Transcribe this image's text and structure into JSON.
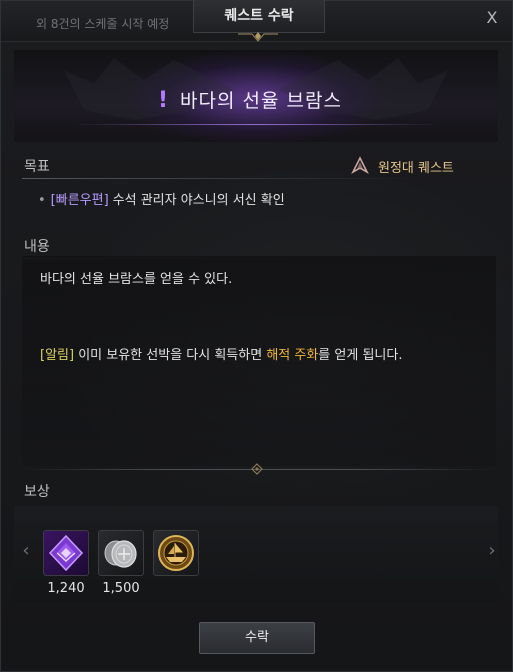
{
  "header": {
    "schedule_notice": "외 8건의 스케줄 시작 예정",
    "title": "퀘스트 수락",
    "close_label": "X"
  },
  "quest": {
    "title": "바다의 선율 브람스",
    "title_prefix": "!",
    "type_label": "원정대 퀘스트"
  },
  "objective": {
    "heading": "목표",
    "bullet": "•",
    "tag": "[빠른우편]",
    "text": "수석 관리자 야스니의 서신 확인"
  },
  "content": {
    "heading": "내용",
    "description": "바다의 선율 브람스를 얻을 수 있다.",
    "notice_tag": "[알림]",
    "notice_before": " 이미 보유한 선박을 다시 획득하면 ",
    "notice_highlight": "해적 주화",
    "notice_after": "를 얻게 됩니다."
  },
  "rewards": {
    "heading": "보상",
    "prev_label": "‹",
    "next_label": "›",
    "items": [
      {
        "icon": "purple-crystal-icon",
        "quantity": "1,240"
      },
      {
        "icon": "silver-coin-icon",
        "quantity": "1,500"
      },
      {
        "icon": "gold-ship-emblem-icon",
        "quantity": ""
      }
    ]
  },
  "actions": {
    "accept_label": "수락"
  },
  "colors": {
    "accent_purple": "#b67cff",
    "tag_purple": "#b89bff",
    "notice_yellow": "#d8d060",
    "highlight_orange": "#f2b63a",
    "type_gold": "#e4c58a"
  }
}
